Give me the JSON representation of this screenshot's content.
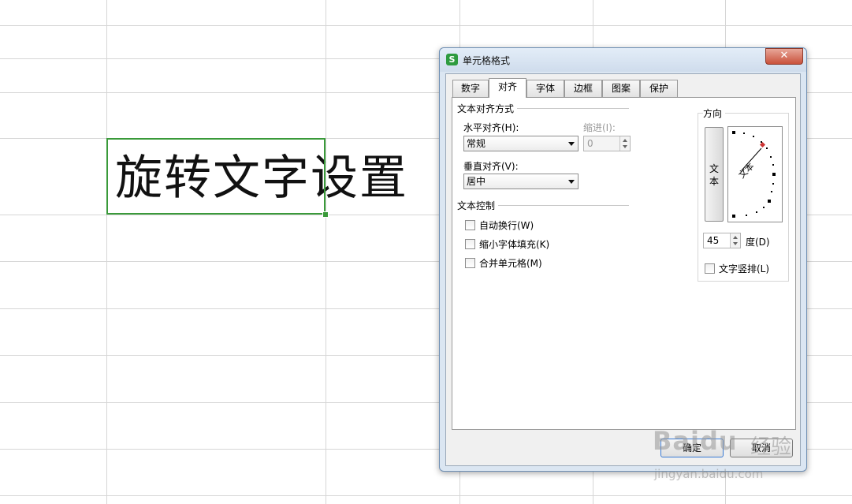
{
  "sheet": {
    "cell_text": "旋转文字设置"
  },
  "dialog": {
    "title": "单元格格式",
    "app_icon": "S",
    "close_glyph": "✕",
    "tabs": [
      {
        "label": "数字"
      },
      {
        "label": "对齐",
        "active": true
      },
      {
        "label": "字体"
      },
      {
        "label": "边框"
      },
      {
        "label": "图案"
      },
      {
        "label": "保护"
      }
    ],
    "alignment": {
      "group_title": "文本对齐方式",
      "horizontal_label": "水平对齐(H):",
      "horizontal_value": "常规",
      "indent_label": "缩进(I):",
      "indent_value": "0",
      "vertical_label": "垂直对齐(V):",
      "vertical_value": "居中"
    },
    "text_control": {
      "group_title": "文本控制",
      "wrap": {
        "label": "自动换行(W)",
        "checked": false
      },
      "shrink": {
        "label": "缩小字体填充(K)",
        "checked": false
      },
      "merge": {
        "label": "合并单元格(M)",
        "checked": false
      }
    },
    "orientation": {
      "group_title": "方向",
      "vertical_text": "文本",
      "dial_text": "文本",
      "degrees_value": "45",
      "degrees_label": "度(D)",
      "vertical_stack": {
        "label": "文字竖排(L)",
        "checked": false
      }
    },
    "buttons": {
      "ok": "确定",
      "cancel": "取消"
    }
  },
  "watermark": {
    "logo": "Baidu",
    "sub": "经验",
    "url": "jingyan.baidu.com"
  },
  "colors": {
    "selection": "#3a9a3a",
    "app_icon": "#2e9b3f",
    "close": "#c9513b",
    "dial_marker": "#cc3333"
  }
}
